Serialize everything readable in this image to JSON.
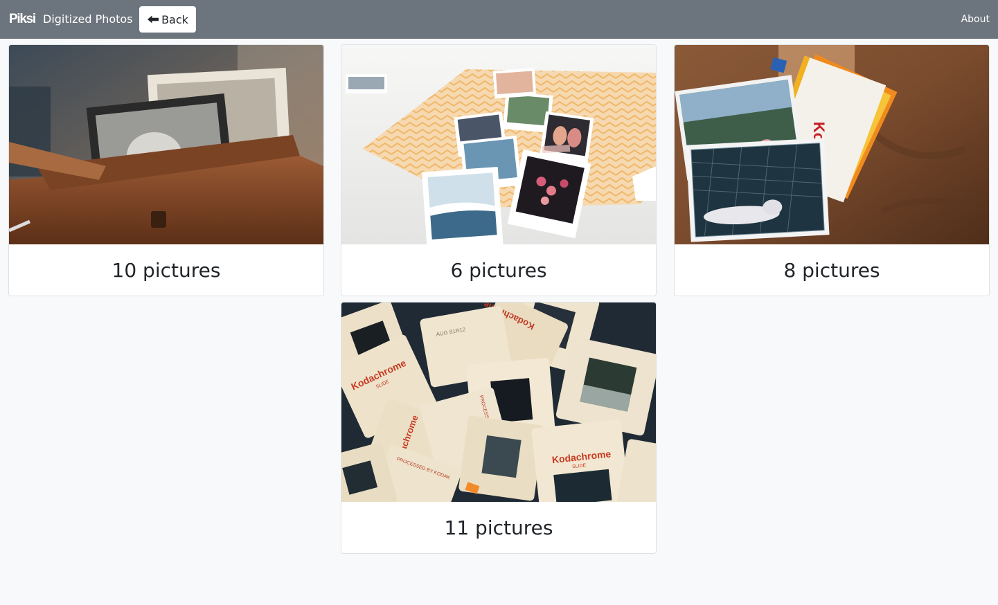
{
  "navbar": {
    "brand": "Piksi",
    "title": "Digitized Photos",
    "back_label": "Back",
    "back_icon": "arrow-left-icon",
    "about_label": "About"
  },
  "albums": [
    {
      "caption": "10 pictures",
      "thumbnail": "vintage-photos-in-wooden-box"
    },
    {
      "caption": "6 pictures",
      "thumbnail": "polaroids-on-open-album"
    },
    {
      "caption": "8 pictures",
      "thumbnail": "prints-with-kodak-envelopes"
    },
    {
      "caption": "11 pictures",
      "thumbnail": "pile-of-kodachrome-slides"
    }
  ],
  "slide_text": {
    "brand": "Kodachrome",
    "sub": "SLIDE",
    "processed": "PROCESSED BY KODAK",
    "date": "AUG 81R12",
    "envelope": "Kodak"
  },
  "colors": {
    "navbar": "#6c757d",
    "page_bg": "#f8f9fa",
    "card_border": "#dee2e6"
  }
}
